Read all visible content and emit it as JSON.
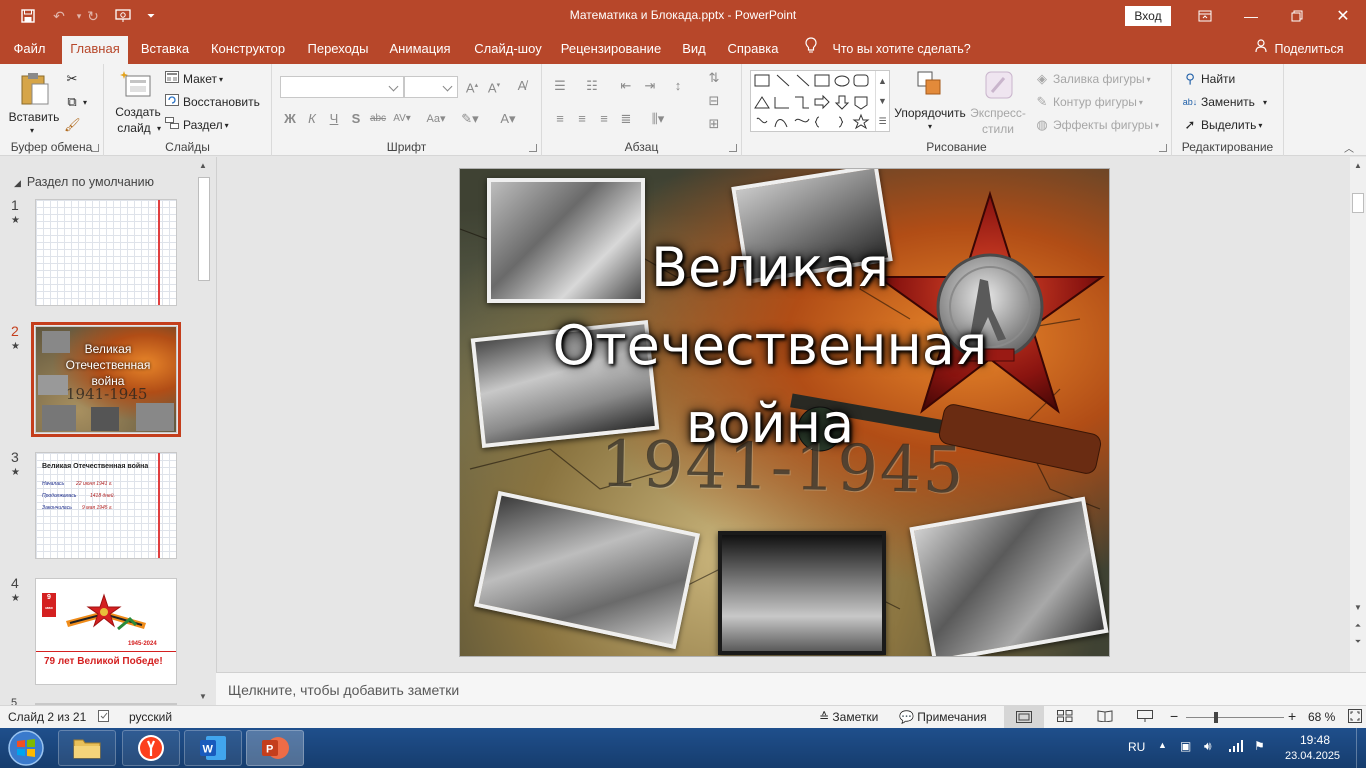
{
  "window": {
    "title": "Математика и Блокада.pptx  -  PowerPoint",
    "signin_label": "Вход"
  },
  "tabs": [
    "Файл",
    "Главная",
    "Вставка",
    "Конструктор",
    "Переходы",
    "Анимация",
    "Слайд-шоу",
    "Рецензирование",
    "Вид",
    "Справка"
  ],
  "tell_me": "Что вы хотите сделать?",
  "share_label": "Поделиться",
  "ribbon": {
    "clipboard": {
      "paste": "Вставить",
      "group": "Буфер обмена"
    },
    "slides": {
      "new_slide_1": "Создать",
      "new_slide_2": "слайд",
      "layout": "Макет",
      "reset": "Восстановить",
      "section": "Раздел",
      "group": "Слайды"
    },
    "font": {
      "group": "Шрифт"
    },
    "paragraph": {
      "group": "Абзац"
    },
    "drawing": {
      "arrange": "Упорядочить",
      "styles_1": "Экспресс-",
      "styles_2": "стили",
      "fill": "Заливка фигуры",
      "outline": "Контур фигуры",
      "effects": "Эффекты фигуры",
      "group": "Рисование"
    },
    "editing": {
      "find": "Найти",
      "replace": "Заменить",
      "select": "Выделить",
      "group": "Редактирование"
    }
  },
  "thumbnails": {
    "section": "Раздел по умолчанию",
    "items": [
      {
        "num": "1",
        "star": "★"
      },
      {
        "num": "2",
        "star": "★",
        "title": "Великая Отечественная война",
        "years": "1941-1945"
      },
      {
        "num": "3",
        "star": "★",
        "heading": "Великая Отечественная война",
        "row1_label": "Началась",
        "row1_value": "22 июня 1941 г.",
        "row2_label": "Продолжалась",
        "row2_value": "1418 дней.",
        "row3_label": "Закончилась",
        "row3_value": "9 мая 1945 г."
      },
      {
        "num": "4",
        "star": "★",
        "badge_num": "9",
        "badge_text": "мая",
        "years": "1945-2024",
        "caption": "79 лет Великой Победе!"
      },
      {
        "num": "5"
      }
    ]
  },
  "slide": {
    "title_line1": "Великая",
    "title_line2": "Отечественная",
    "title_line3": "война",
    "years": "1941-1945"
  },
  "notes_placeholder": "Щелкните, чтобы добавить заметки",
  "status": {
    "slide_info": "Слайд 2 из 21",
    "language": "русский",
    "notes": "Заметки",
    "comments": "Примечания",
    "zoom": "68 %"
  },
  "taskbar": {
    "lang": "RU",
    "time": "19:48",
    "date": "23.04.2025"
  },
  "colors": {
    "accent": "#b7472a",
    "selected": "#c43e1c"
  }
}
